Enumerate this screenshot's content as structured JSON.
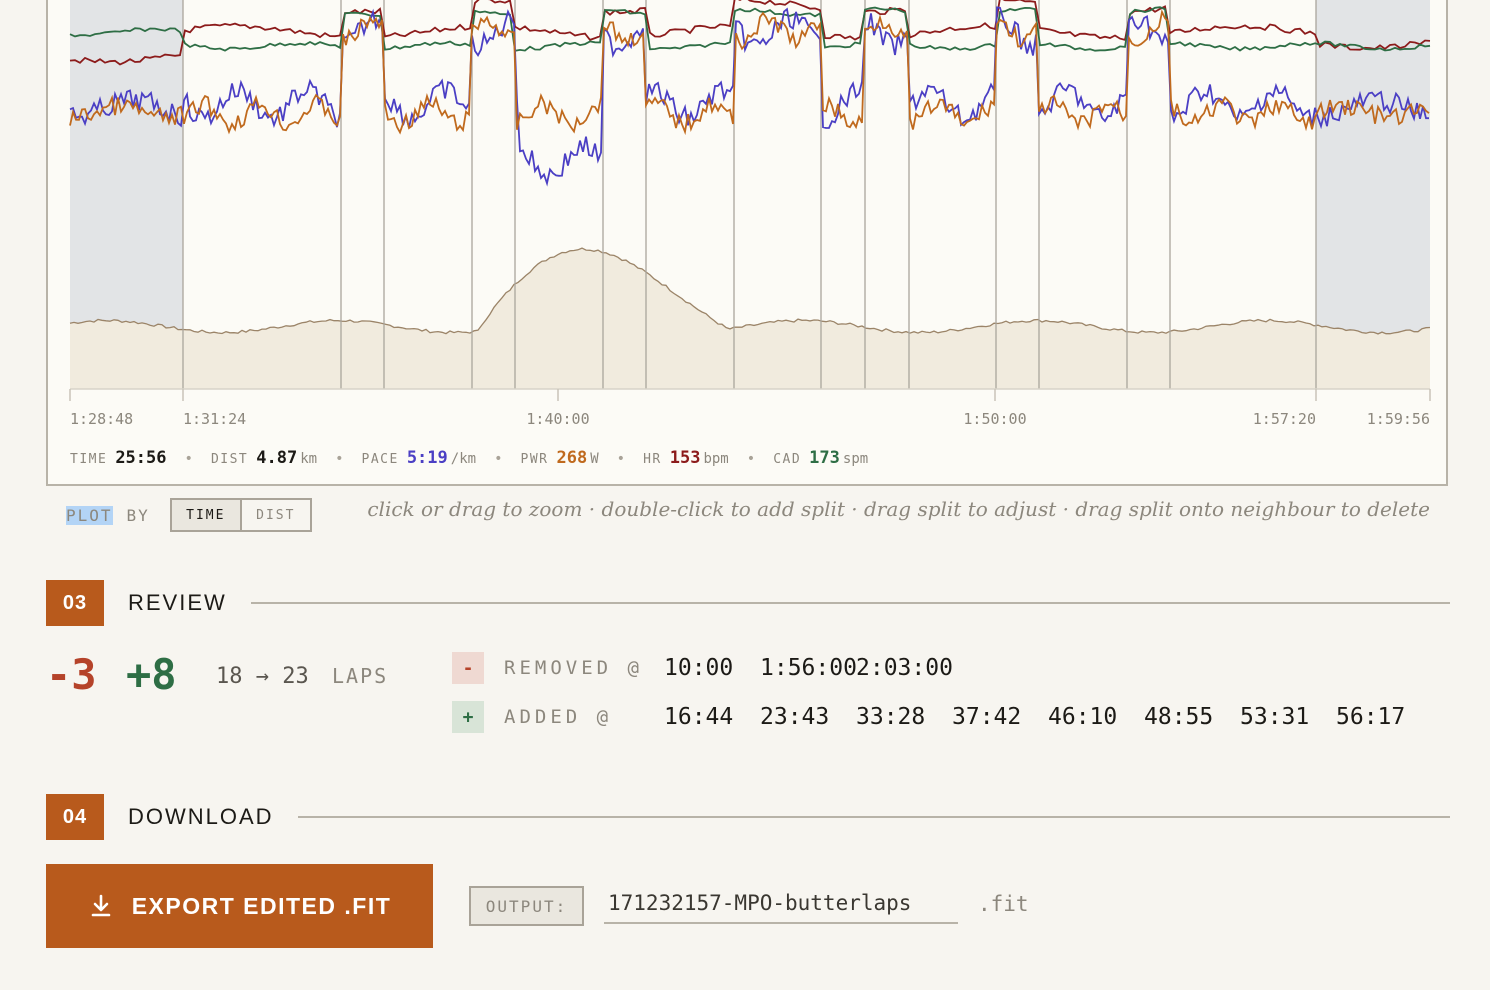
{
  "chart": {
    "x_ticks": [
      "1:28:48",
      "1:31:24",
      "1:40:00",
      "1:50:00",
      "1:57:20",
      "1:59:56"
    ],
    "series_colors": {
      "pace": "#4b3fc4",
      "power": "#c06a1e",
      "hr": "#8c1b1b",
      "cadence": "#2e6e45",
      "elevation": "#9b8468"
    },
    "stats": [
      {
        "key": "TIME",
        "value": "25:56",
        "unit": "",
        "color": "#1c1a16"
      },
      {
        "key": "DIST",
        "value": "4.87",
        "unit": "km",
        "color": "#1c1a16"
      },
      {
        "key": "PACE",
        "value": "5:19",
        "unit": "/km",
        "color": "#4b3fc4"
      },
      {
        "key": "PWR",
        "value": "268",
        "unit": "W",
        "color": "#c06a1e"
      },
      {
        "key": "HR",
        "value": "153",
        "unit": "bpm",
        "color": "#8c1b1b"
      },
      {
        "key": "CAD",
        "value": "173",
        "unit": "spm",
        "color": "#2e6e45"
      }
    ],
    "separator": "•"
  },
  "plotby": {
    "label_plot": "PLOT",
    "label_by": "BY",
    "options": [
      "TIME",
      "DIST"
    ],
    "selected": "TIME"
  },
  "hint": "click or drag to zoom · double-click to add split · drag split to adjust · drag split onto neighbour to delete",
  "review": {
    "number": "03",
    "title": "REVIEW",
    "removed_count": "-3",
    "added_count": "+8",
    "laps_from": "18",
    "laps_arrow": "→",
    "laps_to": "23",
    "laps_unit": "LAPS",
    "removed_badge": "-",
    "removed_label": "REMOVED @",
    "removed_times": [
      "10:00",
      "1:56:00",
      "2:03:00"
    ],
    "added_badge": "+",
    "added_label": "ADDED @",
    "added_times": [
      "16:44",
      "23:43",
      "33:28",
      "37:42",
      "46:10",
      "48:55",
      "53:31",
      "56:17"
    ]
  },
  "download": {
    "number": "04",
    "title": "DOWNLOAD",
    "button_label": "EXPORT EDITED .FIT",
    "output_label": "OUTPUT:",
    "output_value": "171232157-MPO-butterlaps",
    "output_ext": ".fit"
  },
  "accent": "#b85a1c"
}
